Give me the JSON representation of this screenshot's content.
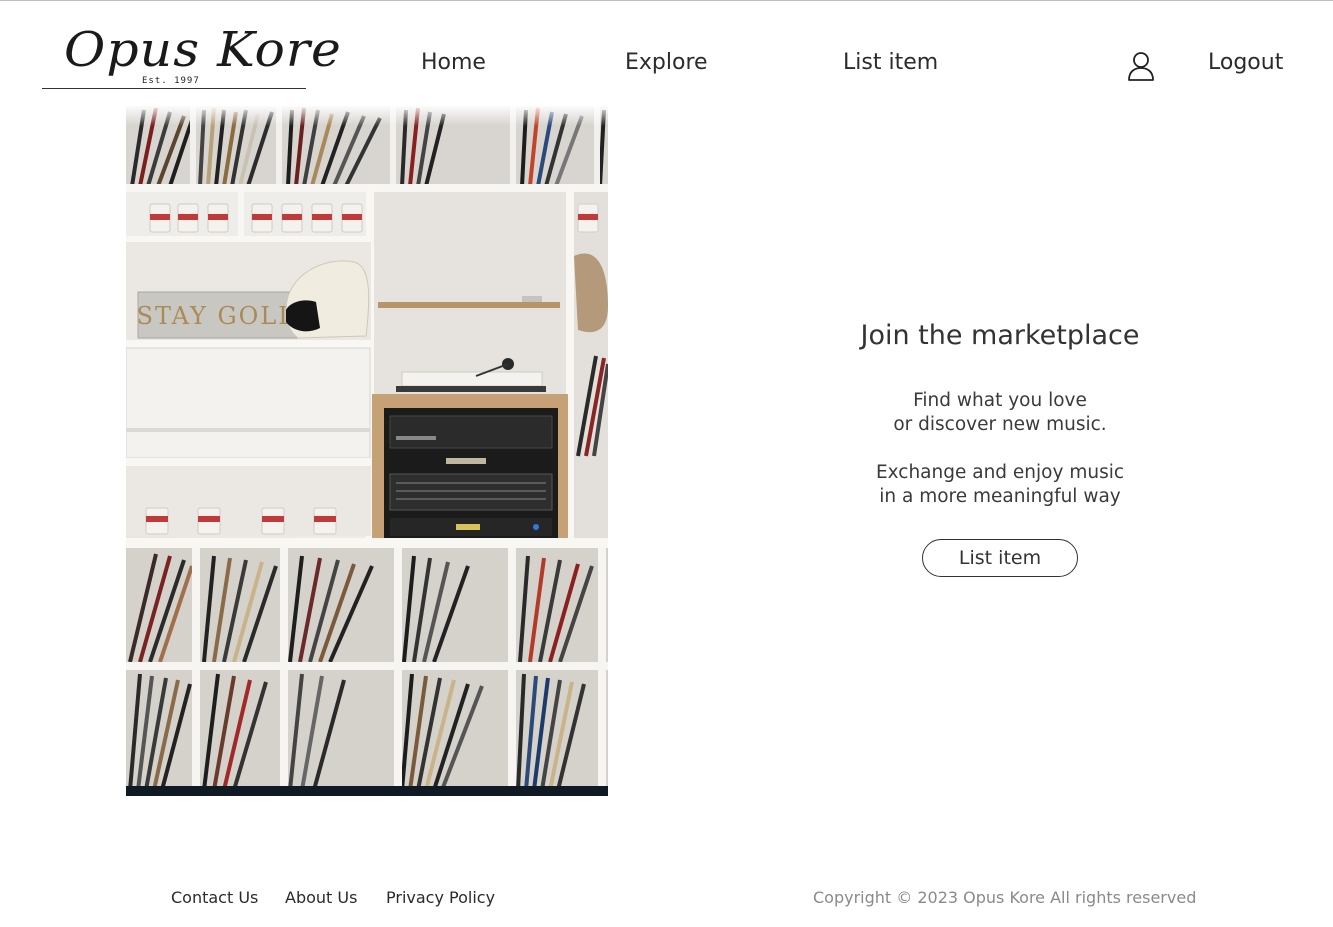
{
  "brand": {
    "logo_text": "Opus Kore",
    "established": "Est. 1997"
  },
  "nav": {
    "home": "Home",
    "explore": "Explore",
    "list_item": "List item",
    "logout": "Logout",
    "user_icon": "user-icon"
  },
  "main": {
    "heading": "Join the marketplace",
    "paragraph1_line1": "Find what you love",
    "paragraph1_line2": "or discover new music.",
    "paragraph2_line1": "Exchange and enjoy music",
    "paragraph2_line2": "in a more meaningful way",
    "cta_label": "List item",
    "image_sign_text": "STAY GOLD"
  },
  "footer": {
    "contact": "Contact Us",
    "about": "About Us",
    "privacy": "Privacy Policy",
    "copyright": "Copyright © 2023 Opus Kore All rights reserved"
  },
  "colors": {
    "text": "#333333",
    "muted": "#8a8a8a",
    "background": "#ffffff"
  }
}
